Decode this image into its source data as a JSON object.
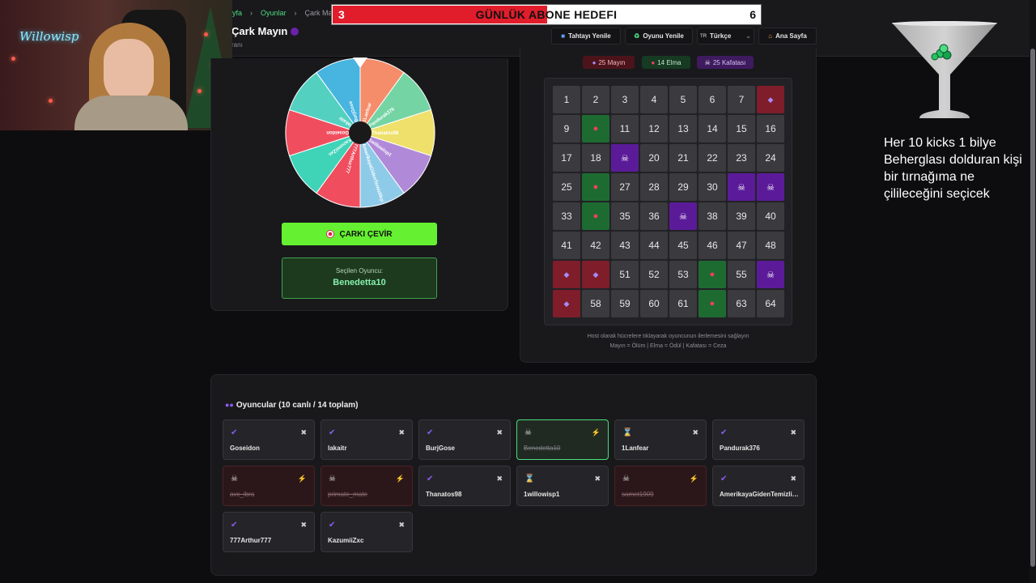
{
  "breadcrumb": [
    "yfa",
    "Oyunlar",
    "Çark Mayın"
  ],
  "page_title": "Çark Mayın",
  "page_subtitle": "ranı",
  "top_buttons": {
    "refresh_board": "Tahtayı Yenile",
    "refresh_game": "Oyunu Yenile",
    "language": "Türkçe",
    "language_flag": "TR",
    "home": "Ana Sayfa"
  },
  "goal": {
    "current": "3",
    "title": "GÜNLÜK ABONE HEDEFI",
    "target": "6",
    "progress": 0.5
  },
  "webcam": {
    "neon_text": "Willowisp"
  },
  "wheel": {
    "segments": [
      {
        "label": "1Lanfear",
        "color": "#f58c6a"
      },
      {
        "label": "Pandurak376",
        "color": "#74d4a4"
      },
      {
        "label": "Thanatos98",
        "color": "#eee06a"
      },
      {
        "label": "1willowisp1",
        "color": "#b08ad8"
      },
      {
        "label": "AmerikayaGidenTemizlikçi",
        "color": "#8ecbe8"
      },
      {
        "label": "777Arthur777",
        "color": "#f04e5e"
      },
      {
        "label": "KazumiiZxc",
        "color": "#3fd3b8"
      },
      {
        "label": "Goseidon",
        "color": "#f04e5e"
      },
      {
        "label": "lakaitr",
        "color": "#54d0c0"
      },
      {
        "label": "BurjGose",
        "color": "#48b4e0"
      }
    ]
  },
  "spin_button": "ÇARKI ÇEVİR",
  "selected": {
    "label": "Seçilen Oyuncu:",
    "name": "Benedetta10"
  },
  "badges": {
    "mines": "25 Mayın",
    "apples": "14 Elma",
    "skulls": "25 Kafatası"
  },
  "board": {
    "cells": [
      {
        "n": "1",
        "t": "num"
      },
      {
        "n": "2",
        "t": "num"
      },
      {
        "n": "3",
        "t": "num"
      },
      {
        "n": "4",
        "t": "num"
      },
      {
        "n": "5",
        "t": "num"
      },
      {
        "n": "6",
        "t": "num"
      },
      {
        "n": "7",
        "t": "num"
      },
      {
        "n": "",
        "t": "mine"
      },
      {
        "n": "9",
        "t": "num"
      },
      {
        "n": "",
        "t": "apple"
      },
      {
        "n": "11",
        "t": "num"
      },
      {
        "n": "12",
        "t": "num"
      },
      {
        "n": "13",
        "t": "num"
      },
      {
        "n": "14",
        "t": "num"
      },
      {
        "n": "15",
        "t": "num"
      },
      {
        "n": "16",
        "t": "num"
      },
      {
        "n": "17",
        "t": "num"
      },
      {
        "n": "18",
        "t": "num"
      },
      {
        "n": "",
        "t": "skull"
      },
      {
        "n": "20",
        "t": "num"
      },
      {
        "n": "21",
        "t": "num"
      },
      {
        "n": "22",
        "t": "num"
      },
      {
        "n": "23",
        "t": "num"
      },
      {
        "n": "24",
        "t": "num"
      },
      {
        "n": "25",
        "t": "num"
      },
      {
        "n": "",
        "t": "apple"
      },
      {
        "n": "27",
        "t": "num"
      },
      {
        "n": "28",
        "t": "num"
      },
      {
        "n": "29",
        "t": "num"
      },
      {
        "n": "30",
        "t": "num"
      },
      {
        "n": "",
        "t": "skull"
      },
      {
        "n": "",
        "t": "skull"
      },
      {
        "n": "33",
        "t": "num"
      },
      {
        "n": "",
        "t": "apple"
      },
      {
        "n": "35",
        "t": "num"
      },
      {
        "n": "36",
        "t": "num"
      },
      {
        "n": "",
        "t": "skull"
      },
      {
        "n": "38",
        "t": "num"
      },
      {
        "n": "39",
        "t": "num"
      },
      {
        "n": "40",
        "t": "num"
      },
      {
        "n": "41",
        "t": "num"
      },
      {
        "n": "42",
        "t": "num"
      },
      {
        "n": "43",
        "t": "num"
      },
      {
        "n": "44",
        "t": "num"
      },
      {
        "n": "45",
        "t": "num"
      },
      {
        "n": "46",
        "t": "num"
      },
      {
        "n": "47",
        "t": "num"
      },
      {
        "n": "48",
        "t": "num"
      },
      {
        "n": "",
        "t": "mine"
      },
      {
        "n": "",
        "t": "mine"
      },
      {
        "n": "51",
        "t": "num"
      },
      {
        "n": "52",
        "t": "num"
      },
      {
        "n": "53",
        "t": "num"
      },
      {
        "n": "",
        "t": "apple"
      },
      {
        "n": "55",
        "t": "num"
      },
      {
        "n": "",
        "t": "skull"
      },
      {
        "n": "",
        "t": "mine"
      },
      {
        "n": "58",
        "t": "num"
      },
      {
        "n": "59",
        "t": "num"
      },
      {
        "n": "60",
        "t": "num"
      },
      {
        "n": "61",
        "t": "num"
      },
      {
        "n": "",
        "t": "apple"
      },
      {
        "n": "63",
        "t": "num"
      },
      {
        "n": "64",
        "t": "num"
      }
    ],
    "note_line1": "Host olarak hücrelere tıklayarak oyuncunun ilerlemesini sağlayın",
    "note_line2": "Mayın = Ölüm | Elma = Ödül | Kafatası = Ceza"
  },
  "players": {
    "title": "Oyuncular (10 canlı / 14 toplam)",
    "list": [
      {
        "name": "Goseidon",
        "status": "alive",
        "action": "kick"
      },
      {
        "name": "lakaitr",
        "status": "alive",
        "action": "kick"
      },
      {
        "name": "BurjGose",
        "status": "alive",
        "action": "kick"
      },
      {
        "name": "Benedetta10",
        "status": "selected",
        "action": "bolt"
      },
      {
        "name": "1Lanfear",
        "status": "waiting",
        "action": "kick"
      },
      {
        "name": "Pandurak376",
        "status": "alive",
        "action": "kick"
      },
      {
        "name": "avc_ibra",
        "status": "dead",
        "action": "bolt"
      },
      {
        "name": "primate_mate",
        "status": "dead",
        "action": "bolt"
      },
      {
        "name": "Thanatos98",
        "status": "alive",
        "action": "kick"
      },
      {
        "name": "1willowisp1",
        "status": "waiting",
        "action": "kick"
      },
      {
        "name": "samet1909",
        "status": "dead",
        "action": "bolt"
      },
      {
        "name": "AmerikayaGidenTemizlikçi",
        "status": "alive",
        "action": "kick"
      },
      {
        "name": "777Arthur777",
        "status": "alive",
        "action": "kick"
      },
      {
        "name": "KazumiiZxc",
        "status": "alive",
        "action": "kick"
      }
    ]
  },
  "overlay_text": "Her 10 kicks 1 bilye Beherglası dolduran kişi bir tırnağıma ne çilileceğini seçicek"
}
